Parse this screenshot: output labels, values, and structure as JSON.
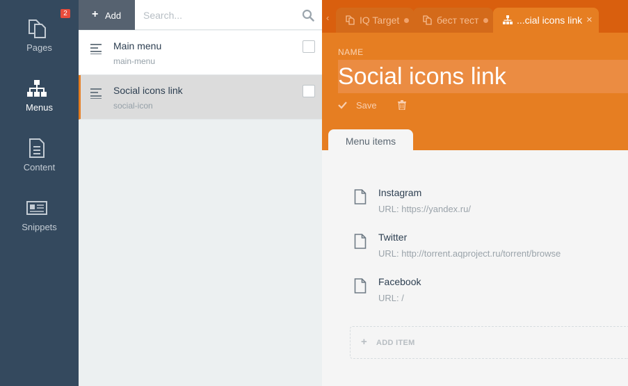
{
  "nav": {
    "items": [
      {
        "label": "Pages",
        "icon": "pages-icon",
        "badge": "2"
      },
      {
        "label": "Menus",
        "icon": "sitemap-icon"
      },
      {
        "label": "Content",
        "icon": "document-icon"
      },
      {
        "label": "Snippets",
        "icon": "newspaper-icon"
      }
    ]
  },
  "list": {
    "add_label": "Add",
    "search_placeholder": "Search...",
    "rows": [
      {
        "title": "Main menu",
        "subtitle": "main-menu"
      },
      {
        "title": "Social icons link",
        "subtitle": "social-icon"
      }
    ]
  },
  "editor": {
    "tabs": [
      {
        "label": "IQ Target"
      },
      {
        "label": "бест тест"
      },
      {
        "label": "...cial icons link"
      }
    ],
    "name_label": "NAME",
    "name_value": "Social icons link",
    "save_label": "Save",
    "section_tab": "Menu items",
    "menu_items": [
      {
        "title": "Instagram",
        "url": "URL: https://yandex.ru/"
      },
      {
        "title": "Twitter",
        "url": "URL: http://torrent.aqproject.ru/torrent/browse"
      },
      {
        "title": "Facebook",
        "url": "URL: /"
      }
    ],
    "add_item_label": "ADD ITEM"
  },
  "colors": {
    "nav_bg": "#34495e",
    "accent": "#e67e22",
    "tabbar_bg": "#d95f0e",
    "badge": "#e74c3c"
  }
}
